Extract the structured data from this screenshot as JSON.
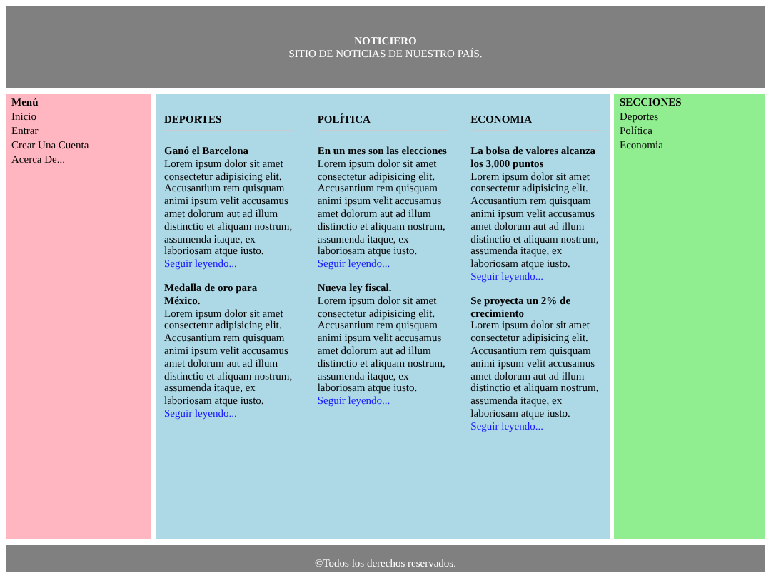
{
  "header": {
    "title": "NOTICIERO",
    "subtitle": "SITIO DE NOTICIAS DE NUESTRO PAÍS."
  },
  "menu": {
    "title": "Menú",
    "items": [
      "Inicio",
      "Entrar",
      "Crear Una Cuenta",
      "Acerca De..."
    ]
  },
  "columns": [
    {
      "heading": "DEPORTES",
      "articles": [
        {
          "title": "Ganó el Barcelona",
          "body": "Lorem ipsum dolor sit amet consectetur adipisicing elit. Accusantium rem quisquam animi ipsum velit accusamus amet dolorum aut ad illum distinctio et aliquam nostrum, assumenda itaque, ex laboriosam atque iusto.",
          "link": "Seguir leyendo..."
        },
        {
          "title": "Medalla de oro para México.",
          "body": "Lorem ipsum dolor sit amet consectetur adipisicing elit. Accusantium rem quisquam animi ipsum velit accusamus amet dolorum aut ad illum distinctio et aliquam nostrum, assumenda itaque, ex laboriosam atque iusto.",
          "link": "Seguir leyendo..."
        }
      ]
    },
    {
      "heading": "POLÍTICA",
      "articles": [
        {
          "title": "En un mes son las elecciones",
          "body": "Lorem ipsum dolor sit amet consectetur adipisicing elit. Accusantium rem quisquam animi ipsum velit accusamus amet dolorum aut ad illum distinctio et aliquam nostrum, assumenda itaque, ex laboriosam atque iusto.",
          "link": "Seguir leyendo..."
        },
        {
          "title": "Nueva ley fiscal.",
          "body": "Lorem ipsum dolor sit amet consectetur adipisicing elit. Accusantium rem quisquam animi ipsum velit accusamus amet dolorum aut ad illum distinctio et aliquam nostrum, assumenda itaque, ex laboriosam atque iusto.",
          "link": "Seguir leyendo..."
        }
      ]
    },
    {
      "heading": "ECONOMIA",
      "articles": [
        {
          "title": "La bolsa de valores alcanza los 3,000 puntos",
          "body": "Lorem ipsum dolor sit amet consectetur adipisicing elit. Accusantium rem quisquam animi ipsum velit accusamus amet dolorum aut ad illum distinctio et aliquam nostrum, assumenda itaque, ex laboriosam atque iusto.",
          "link": "Seguir leyendo..."
        },
        {
          "title": "Se proyecta un 2% de crecimiento",
          "body": "Lorem ipsum dolor sit amet consectetur adipisicing elit. Accusantium rem quisquam animi ipsum velit accusamus amet dolorum aut ad illum distinctio et aliquam nostrum, assumenda itaque, ex laboriosam atque iusto.",
          "link": "Seguir leyendo..."
        }
      ]
    }
  ],
  "sections": {
    "title": "SECCIONES",
    "items": [
      "Deportes",
      "Política",
      "Economia"
    ]
  },
  "footer": "©Todos los derechos reservados."
}
